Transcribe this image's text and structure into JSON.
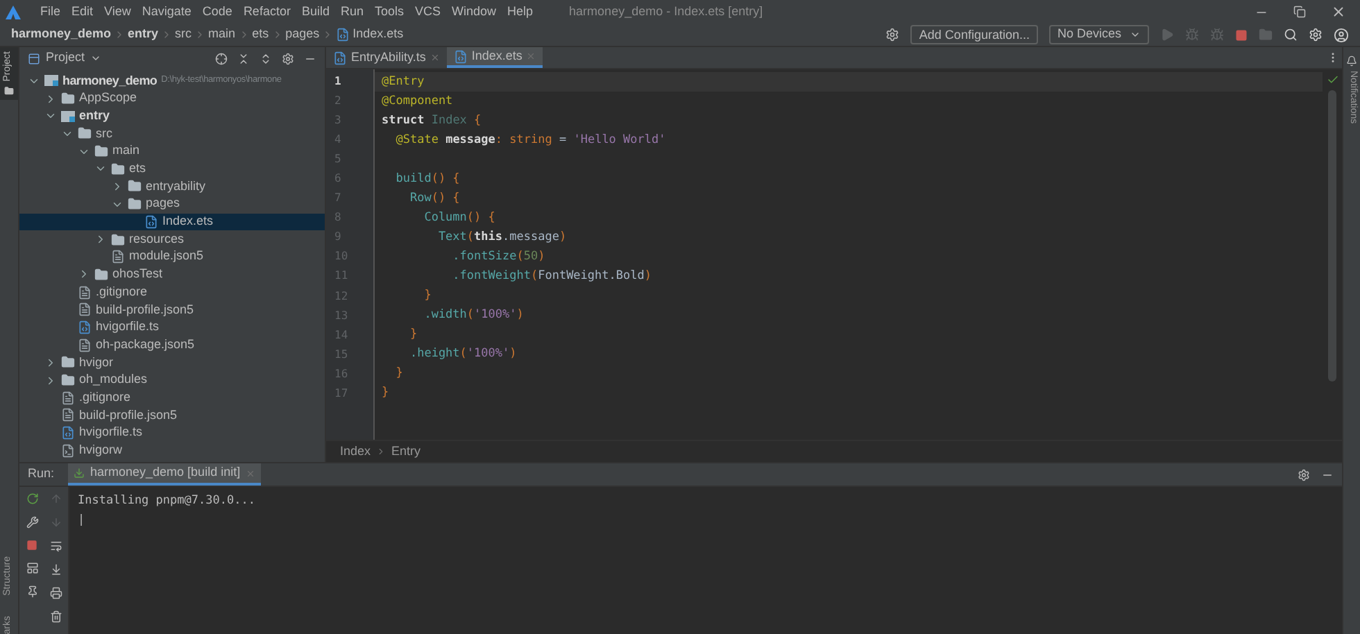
{
  "menu": [
    "File",
    "Edit",
    "View",
    "Navigate",
    "Code",
    "Refactor",
    "Build",
    "Run",
    "Tools",
    "VCS",
    "Window",
    "Help"
  ],
  "window": {
    "title": "harmoney_demo - Index.ets [entry]"
  },
  "breadcrumb": [
    {
      "label": "harmoney_demo",
      "bold": true
    },
    {
      "label": "entry",
      "bold": true
    },
    {
      "label": "src",
      "bold": false
    },
    {
      "label": "main",
      "bold": false
    },
    {
      "label": "ets",
      "bold": false
    },
    {
      "label": "pages",
      "bold": false
    },
    {
      "label": "Index.ets",
      "bold": false,
      "kind": "ets_file"
    }
  ],
  "toolbar": {
    "config_button": "Add Configuration...",
    "device_select": "No Devices"
  },
  "left_strip": {
    "top": "Project",
    "bottom": [
      "Structure",
      "arks"
    ]
  },
  "right_strip": {
    "label": "Notifications"
  },
  "project": {
    "title": "Project",
    "tree": [
      {
        "name": "harmoney_demo",
        "path": "D:\\hyk-test\\harmonyos\\harmone",
        "kind": "module",
        "bold": true,
        "expanded": true,
        "selected": false,
        "children": [
          {
            "name": "AppScope",
            "kind": "folder",
            "expanded": false,
            "selected": false
          },
          {
            "name": "entry",
            "kind": "module",
            "bold": true,
            "expanded": true,
            "selected": false,
            "children": [
              {
                "name": "src",
                "kind": "folder",
                "expanded": true,
                "selected": false,
                "children": [
                  {
                    "name": "main",
                    "kind": "folder",
                    "expanded": true,
                    "selected": false,
                    "children": [
                      {
                        "name": "ets",
                        "kind": "folder",
                        "expanded": true,
                        "selected": false,
                        "children": [
                          {
                            "name": "entryability",
                            "kind": "folder",
                            "expanded": false,
                            "selected": false
                          },
                          {
                            "name": "pages",
                            "kind": "folder",
                            "expanded": true,
                            "selected": false,
                            "children": [
                              {
                                "name": "Index.ets",
                                "kind": "ets_file",
                                "selected": true
                              }
                            ]
                          }
                        ]
                      },
                      {
                        "name": "resources",
                        "kind": "folder",
                        "expanded": false,
                        "selected": false
                      },
                      {
                        "name": "module.json5",
                        "kind": "json_file",
                        "selected": false
                      }
                    ]
                  },
                  {
                    "name": "ohosTest",
                    "kind": "folder",
                    "expanded": false,
                    "selected": false
                  }
                ]
              },
              {
                "name": ".gitignore",
                "kind": "json_file",
                "selected": false
              },
              {
                "name": "build-profile.json5",
                "kind": "json_file",
                "selected": false
              },
              {
                "name": "hvigorfile.ts",
                "kind": "ets_file",
                "selected": false
              },
              {
                "name": "oh-package.json5",
                "kind": "json_file",
                "selected": false
              }
            ]
          },
          {
            "name": "hvigor",
            "kind": "folder",
            "expanded": false,
            "selected": false
          },
          {
            "name": "oh_modules",
            "kind": "folder",
            "expanded": false,
            "selected": false
          },
          {
            "name": ".gitignore",
            "kind": "json_file",
            "selected": false
          },
          {
            "name": "build-profile.json5",
            "kind": "json_file",
            "selected": false
          },
          {
            "name": "hvigorfile.ts",
            "kind": "ets_file",
            "selected": false
          },
          {
            "name": "hvigorw",
            "kind": "script",
            "selected": false
          }
        ]
      }
    ]
  },
  "editor_tabs": [
    {
      "label": "EntryAbility.ts",
      "selected": false
    },
    {
      "label": "Index.ets",
      "selected": true
    }
  ],
  "code": [
    {
      "num": "1",
      "current": true,
      "tokens": [
        {
          "text": "@Entry",
          "kind": "annotation"
        }
      ]
    },
    {
      "num": "2",
      "current": false,
      "tokens": [
        {
          "text": "@Component",
          "kind": "annotation"
        }
      ]
    },
    {
      "num": "3",
      "current": false,
      "tokens": [
        {
          "text": "struct",
          "kind": "keyword"
        },
        {
          "text": " Index ",
          "kind": "type"
        },
        {
          "text": "{",
          "kind": "punct"
        }
      ]
    },
    {
      "num": "4",
      "current": false,
      "tokens": [
        {
          "text": "  @State",
          "kind": "annotation"
        },
        {
          "text": " message",
          "kind": "keyword"
        },
        {
          "text": ": string",
          "kind": "punct"
        },
        {
          "text": " = ",
          "kind": "plain"
        },
        {
          "text": "'Hello World'",
          "kind": "string"
        }
      ]
    },
    {
      "num": "5",
      "current": false
    },
    {
      "num": "6",
      "current": false,
      "tokens": [
        {
          "text": "  build",
          "kind": "call"
        },
        {
          "text": "() {",
          "kind": "punct"
        }
      ]
    },
    {
      "num": "7",
      "current": false,
      "tokens": [
        {
          "text": "    Row",
          "kind": "call"
        },
        {
          "text": "() {",
          "kind": "punct"
        }
      ]
    },
    {
      "num": "8",
      "current": false,
      "tokens": [
        {
          "text": "      Column",
          "kind": "call"
        },
        {
          "text": "() {",
          "kind": "punct"
        }
      ]
    },
    {
      "num": "9",
      "current": false,
      "tokens": [
        {
          "text": "        Text",
          "kind": "call"
        },
        {
          "text": "(",
          "kind": "punct"
        },
        {
          "text": "this",
          "kind": "keyword"
        },
        {
          "text": ".message",
          "kind": "plain"
        },
        {
          "text": ")",
          "kind": "punct"
        }
      ]
    },
    {
      "num": "10",
      "current": false,
      "tokens": [
        {
          "text": "          .fontSize",
          "kind": "call"
        },
        {
          "text": "(",
          "kind": "punct"
        },
        {
          "text": "50",
          "kind": "number"
        },
        {
          "text": ")",
          "kind": "punct"
        }
      ]
    },
    {
      "num": "11",
      "current": false,
      "tokens": [
        {
          "text": "          .fontWeight",
          "kind": "call"
        },
        {
          "text": "(",
          "kind": "punct"
        },
        {
          "text": "FontWeight.Bold",
          "kind": "plain"
        },
        {
          "text": ")",
          "kind": "punct"
        }
      ]
    },
    {
      "num": "12",
      "current": false,
      "tokens": [
        {
          "text": "      }",
          "kind": "punct"
        }
      ]
    },
    {
      "num": "13",
      "current": false,
      "tokens": [
        {
          "text": "      .width",
          "kind": "call"
        },
        {
          "text": "(",
          "kind": "punct"
        },
        {
          "text": "'100%'",
          "kind": "string"
        },
        {
          "text": ")",
          "kind": "punct"
        }
      ]
    },
    {
      "num": "14",
      "current": false,
      "tokens": [
        {
          "text": "    }",
          "kind": "punct"
        }
      ]
    },
    {
      "num": "15",
      "current": false,
      "tokens": [
        {
          "text": "    .height",
          "kind": "call"
        },
        {
          "text": "(",
          "kind": "punct"
        },
        {
          "text": "'100%'",
          "kind": "string"
        },
        {
          "text": ")",
          "kind": "punct"
        }
      ]
    },
    {
      "num": "16",
      "current": false,
      "tokens": [
        {
          "text": "  }",
          "kind": "punct"
        }
      ]
    },
    {
      "num": "17",
      "current": false,
      "tokens": [
        {
          "text": "}",
          "kind": "punct"
        }
      ]
    }
  ],
  "editor_breadcrumb": [
    "Index",
    "Entry"
  ],
  "run": {
    "label": "Run:",
    "tab": "harmoney_demo [build init]",
    "output": [
      "Installing pnpm@7.30.0...",
      "|"
    ]
  }
}
